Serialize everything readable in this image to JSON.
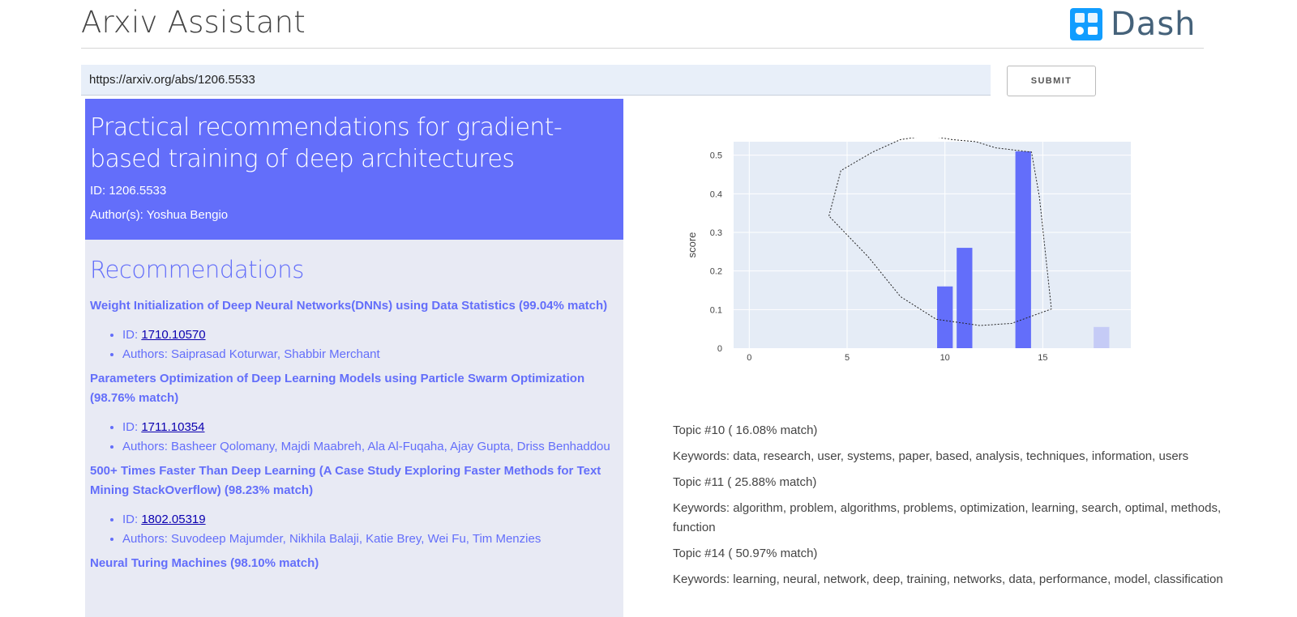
{
  "header": {
    "title": "Arxiv Assistant",
    "logo_text": "Dash",
    "logo_icon": "dash-logo-icon"
  },
  "search": {
    "value": "https://arxiv.org/abs/1206.5533",
    "submit_label": "SUBMIT"
  },
  "paper": {
    "title": "Practical recommendations for gradient-based training of deep architectures",
    "id_line": "ID: 1206.5533",
    "authors_line": "Author(s): Yoshua Bengio"
  },
  "recommendations": {
    "heading": "Recommendations",
    "items": [
      {
        "title": "Weight Initialization of Deep Neural Networks(DNNs) using Data Statistics (99.04% match)",
        "id_prefix": "ID: ",
        "id": "1710.10570",
        "authors": "Authors: Saiprasad Koturwar, Shabbir Merchant"
      },
      {
        "title": "Parameters Optimization of Deep Learning Models using Particle Swarm Optimization (98.76% match)",
        "id_prefix": "ID: ",
        "id": "1711.10354",
        "authors": "Authors: Basheer Qolomany, Majdi Maabreh, Ala Al-Fuqaha, Ajay Gupta, Driss Benhaddou"
      },
      {
        "title": "500+ Times Faster Than Deep Learning (A Case Study Exploring Faster Methods for Text Mining StackOverflow) (98.23% match)",
        "id_prefix": "ID: ",
        "id": "1802.05319",
        "authors": "Authors: Suvodeep Majumder, Nikhila Balaji, Katie Brey, Wei Fu, Tim Menzies"
      },
      {
        "title": "Neural Turing Machines (98.10% match)"
      }
    ]
  },
  "chart_data": {
    "type": "bar",
    "xlabel": "",
    "ylabel": "score",
    "x": [
      10,
      11,
      14,
      18
    ],
    "values": [
      0.16,
      0.26,
      0.51,
      0.055
    ],
    "highlighted": [
      true,
      true,
      true,
      false
    ],
    "xlim": [
      -0.8,
      19.5
    ],
    "ylim": [
      0,
      0.535
    ],
    "xticks": [
      0,
      5,
      10,
      15
    ],
    "yticks": [
      0,
      0.1,
      0.2,
      0.3,
      0.4,
      0.5
    ],
    "ytick_labels": [
      "0",
      "0.1",
      "0.2",
      "0.3",
      "0.4",
      "0.5"
    ],
    "grid": true,
    "colors": {
      "bar": "#636efa",
      "bar_dim": "#c5cbf6",
      "plot_bg": "#e5ecf6"
    },
    "lasso_selection": true
  },
  "topics": [
    {
      "header": "Topic #10 ( 16.08% match)",
      "keywords": "Keywords: data, research, user, systems, paper, based, analysis, techniques, information, users"
    },
    {
      "header": "Topic #11 ( 25.88% match)",
      "keywords": "Keywords: algorithm, problem, algorithms, problems, optimization, learning, search, optimal, methods, function"
    },
    {
      "header": "Topic #14 ( 50.97% match)",
      "keywords": "Keywords: learning, neural, network, deep, training, networks, data, performance, model, classification"
    }
  ],
  "colors": {
    "accent": "#636efa",
    "panel_bg": "#e8eaf4",
    "input_bg": "#e8eff9",
    "link": "#0b00b0"
  }
}
